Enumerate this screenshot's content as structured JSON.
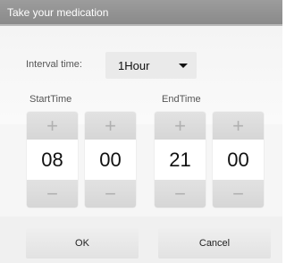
{
  "dialog": {
    "title": "Take your medication"
  },
  "interval": {
    "label": "Interval time:",
    "value": "1Hour"
  },
  "start": {
    "label": "StartTime",
    "hour": "08",
    "minute": "00"
  },
  "end": {
    "label": "EndTime",
    "hour": "21",
    "minute": "00"
  },
  "spinner": {
    "plus": "+",
    "minus": "−"
  },
  "buttons": {
    "ok": "OK",
    "cancel": "Cancel"
  }
}
